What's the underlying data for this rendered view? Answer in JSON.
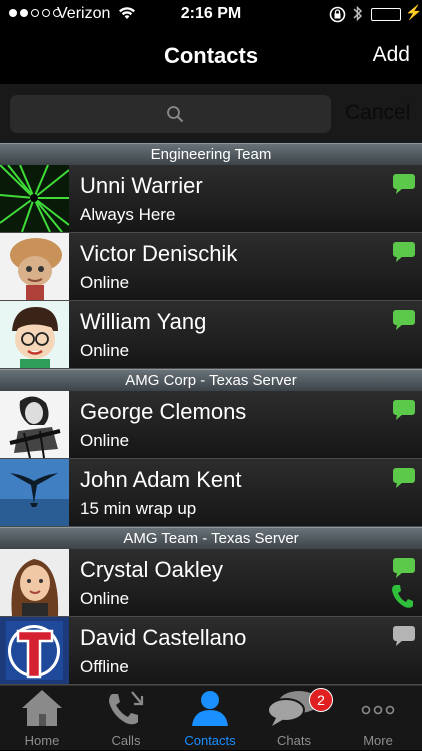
{
  "status_bar": {
    "carrier": "Verizon",
    "time": "2:16 PM",
    "signal_bars": 2,
    "signal_total": 5
  },
  "nav": {
    "title": "Contacts",
    "add_label": "Add"
  },
  "search": {
    "cancel_label": "Cancel"
  },
  "sections": [
    {
      "title": "Engineering Team",
      "contacts": [
        {
          "name": "Unni Warrier",
          "status": "Always Here",
          "chat_color": "#5cc94a",
          "avatar": "green-burst"
        },
        {
          "name": "Victor Denischik",
          "status": "Online",
          "chat_color": "#5cc94a",
          "avatar": "doll"
        },
        {
          "name": "William Yang",
          "status": "Online",
          "chat_color": "#5cc94a",
          "avatar": "cartoon-boy"
        }
      ]
    },
    {
      "title": "AMG Corp - Texas Server",
      "contacts": [
        {
          "name": "George Clemons",
          "status": "Online",
          "chat_color": "#5cc94a",
          "avatar": "guitarist-sketch"
        },
        {
          "name": "John Adam Kent",
          "status": "15 min wrap up",
          "chat_color": "#5cc94a",
          "avatar": "whale-tail"
        }
      ]
    },
    {
      "title": "AMG Team - Texas Server",
      "contacts": [
        {
          "name": "Crystal Oakley",
          "status": "Online",
          "chat_color": "#5cc94a",
          "phone": true,
          "avatar": "woman-portrait"
        },
        {
          "name": "David Castellano",
          "status": "Offline",
          "chat_color": "#b4b4b4",
          "avatar": "rangers-logo"
        }
      ]
    }
  ],
  "tabs": [
    {
      "label": "Home",
      "icon": "home-icon",
      "active": false
    },
    {
      "label": "Calls",
      "icon": "phone-calls-icon",
      "active": false
    },
    {
      "label": "Contacts",
      "icon": "person-icon",
      "active": true
    },
    {
      "label": "Chats",
      "icon": "chat-bubbles-icon",
      "active": false,
      "badge": "2"
    },
    {
      "label": "More",
      "icon": "more-dots-icon",
      "active": false
    }
  ],
  "colors": {
    "accent": "#1a8fff",
    "online_chat": "#5cc94a",
    "offline_chat": "#b4b4b4",
    "phone_green": "#2fbf3a",
    "badge_red": "#e02020"
  }
}
